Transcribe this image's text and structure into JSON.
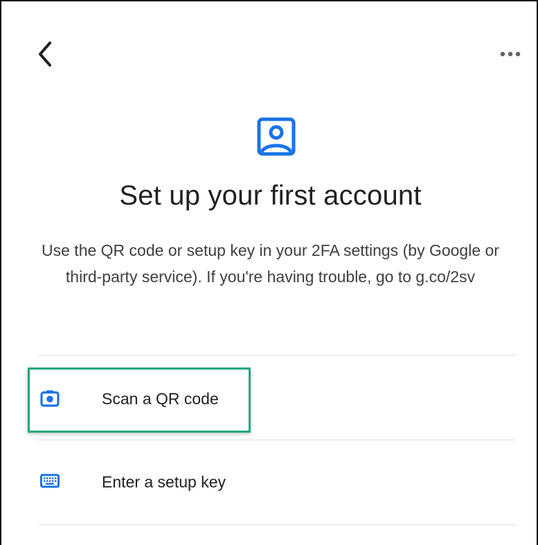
{
  "header": {
    "back_icon": "chevron-left-icon",
    "more_icon": "more-horizontal-icon"
  },
  "hero": {
    "icon": "account-box-icon",
    "title": "Set up your first account",
    "description": "Use the QR code or setup key in your 2FA settings (by Google or third-party service). If you're having trouble, go to g.co/2sv"
  },
  "options": [
    {
      "icon": "camera-icon",
      "label": "Scan a QR code"
    },
    {
      "icon": "keyboard-icon",
      "label": "Enter a setup key"
    }
  ],
  "colors": {
    "accent_blue": "#1a73e8",
    "highlight_green": "#1ea67f",
    "divider": "#dadce0"
  }
}
